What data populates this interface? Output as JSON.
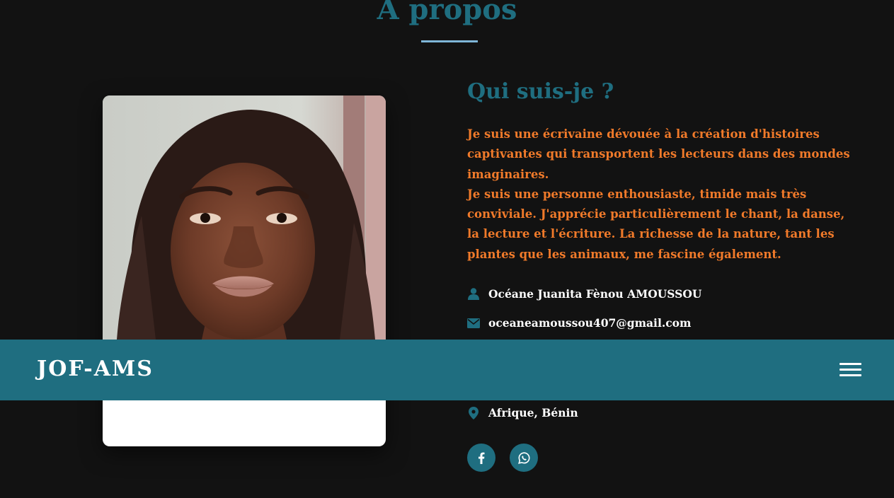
{
  "section": {
    "title": "À propos"
  },
  "about": {
    "heading": "Qui suis-je ?",
    "bio_paragraph_1": "Je suis une écrivaine dévouée à la création d'histoires captivantes qui transportent les lecteurs dans des mondes imaginaires.",
    "bio_paragraph_2": "Je suis une personne enthousiaste, timide mais très conviviale. J'apprécie particulièrement le chant, la danse, la lecture et l'écriture. La richesse de la nature, tant les plantes que les animaux, me fascine également."
  },
  "info": {
    "name": "Océane Juanita Fènou AMOUSSOU",
    "email": "oceaneamoussou407@gmail.com",
    "location": "Afrique, Bénin"
  },
  "navbar": {
    "brand": "JOF-AMS"
  },
  "icons": {
    "user": "user-icon",
    "email": "envelope-icon",
    "location": "map-marker-icon",
    "facebook": "facebook-icon",
    "whatsapp": "whatsapp-icon",
    "menu": "hamburger-menu-icon"
  },
  "colors": {
    "background": "#121212",
    "accent": "#1f6e80",
    "bio_text": "#f07a2a",
    "underline": "#7fb6d8",
    "text": "#ffffff"
  }
}
